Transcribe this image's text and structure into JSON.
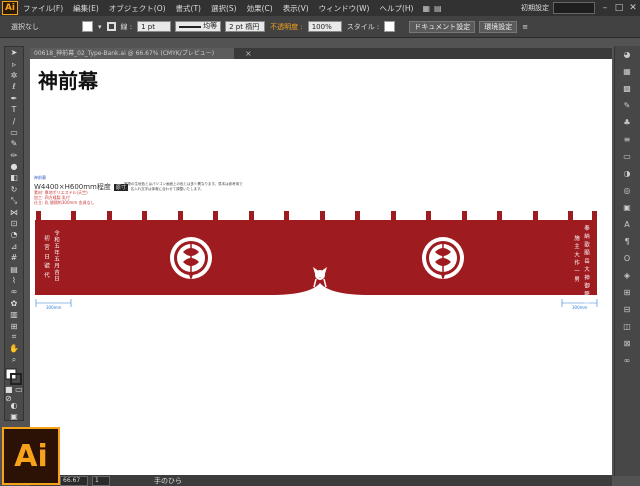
{
  "app": {
    "logo_text": "Ai",
    "big_logo_text": "Ai"
  },
  "menubar": {
    "items": [
      "ファイル(F)",
      "編集(E)",
      "オブジェクト(O)",
      "書式(T)",
      "選択(S)",
      "効果(C)",
      "表示(V)",
      "ウィンドウ(W)",
      "ヘルプ(H)"
    ],
    "workspace": "初期設定"
  },
  "controlbar": {
    "selection_label": "選択なし",
    "stroke_label": "線 :",
    "stroke_value": "1 pt",
    "profile_label": "均等",
    "brush_value": "2 pt 楕円",
    "opacity_label": "不透明度 :",
    "opacity_value": "100%",
    "style_label": "スタイル :",
    "doc_setup_button": "ドキュメント設定",
    "prefs_button": "環境設定"
  },
  "document": {
    "tab_name": "00618_神前幕_02_Type-Bank.ai @ 66.67% (CMYK/プレビュー)",
    "title": "神前幕",
    "spec_small": "神前幕",
    "size_text": "W4400×H600mm程度",
    "size_badge": "原寸",
    "note_text": "実物の生地色とはパソコン画面上の色とは多少異なります。見本は参考用です。名入れ文字は体裁に合わせて調整いたします。",
    "material_lines": [
      "素材: 厚地ポリエステル(天竺)",
      "加工: 四方縫製 乳付",
      "仕立: 乳 間隔約300mm 金具なし"
    ],
    "left_text_col1": "令和五年五月吉日",
    "left_text_col2": "初 宮 日 號 代",
    "right_text_col1": "奉 納 歌 願 岳 大 神 御 籠 祈",
    "right_text_col2": "施 主 大 作 一 男",
    "dim_left": "300mm",
    "dim_right": "300mm"
  },
  "statusbar": {
    "zoom_value": "66.67",
    "page_value": "1",
    "tool_name": "手のひら"
  },
  "colors": {
    "banner": "#9e1b20",
    "accent": "#f7a21b"
  }
}
